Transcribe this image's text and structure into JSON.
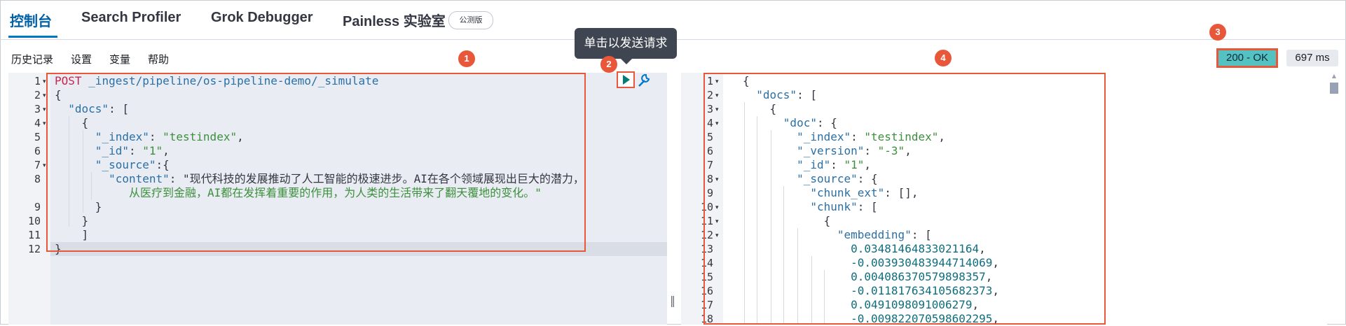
{
  "tabs": [
    {
      "label": "控制台"
    },
    {
      "label": "Search Profiler"
    },
    {
      "label": "Grok Debugger"
    },
    {
      "label": "Painless 实验室"
    }
  ],
  "beta_badge": "公测版",
  "subnav": {
    "history": "历史记录",
    "settings": "设置",
    "variables": "变量",
    "help": "帮助"
  },
  "tooltip": "单击以发送请求",
  "callouts": [
    "1",
    "2",
    "3",
    "4"
  ],
  "status": {
    "code": "200 - OK",
    "time": "697 ms"
  },
  "request": {
    "line_numbers": [
      "1",
      "2",
      "3",
      "4",
      "5",
      "6",
      "7",
      "8",
      "",
      "9",
      "10",
      "11",
      "12"
    ],
    "lines": [
      "POST _ingest/pipeline/os-pipeline-demo/_simulate",
      "{",
      "  \"docs\": [",
      "    {",
      "      \"_index\": \"testindex\",",
      "      \"_id\": \"1\",",
      "      \"_source\":{",
      "        \"content\": \"现代科技的发展推动了人工智能的极速进步。AI在各个领域展现出巨大的潜力，",
      "           从医疗到金融，AI都在发挥着重要的作用，为人类的生活带来了翻天覆地的变化。\"",
      "      }",
      "    }",
      "    ]",
      "}"
    ]
  },
  "response": {
    "line_numbers": [
      "1",
      "2",
      "3",
      "4",
      "5",
      "6",
      "7",
      "8",
      "9",
      "10",
      "11",
      "12",
      "13",
      "14",
      "15",
      "16",
      "17",
      "18"
    ],
    "lines": [
      "{",
      "  \"docs\": [",
      "    {",
      "      \"doc\": {",
      "        \"_index\": \"testindex\",",
      "        \"_version\": \"-3\",",
      "        \"_id\": \"1\",",
      "        \"_source\": {",
      "          \"chunk_ext\": [],",
      "          \"chunk\": [",
      "            {",
      "              \"embedding\": [",
      "                0.03481464833021164,",
      "                -0.003930483944714069,",
      "                0.004086370579898357,",
      "                -0.011817634105682373,",
      "                0.0491098091006279,",
      "                -0.009822070598602295,"
    ]
  },
  "colors": {
    "accent": "#0077cc",
    "highlight": "#e8573a",
    "status_ok": "#54c2c0"
  }
}
